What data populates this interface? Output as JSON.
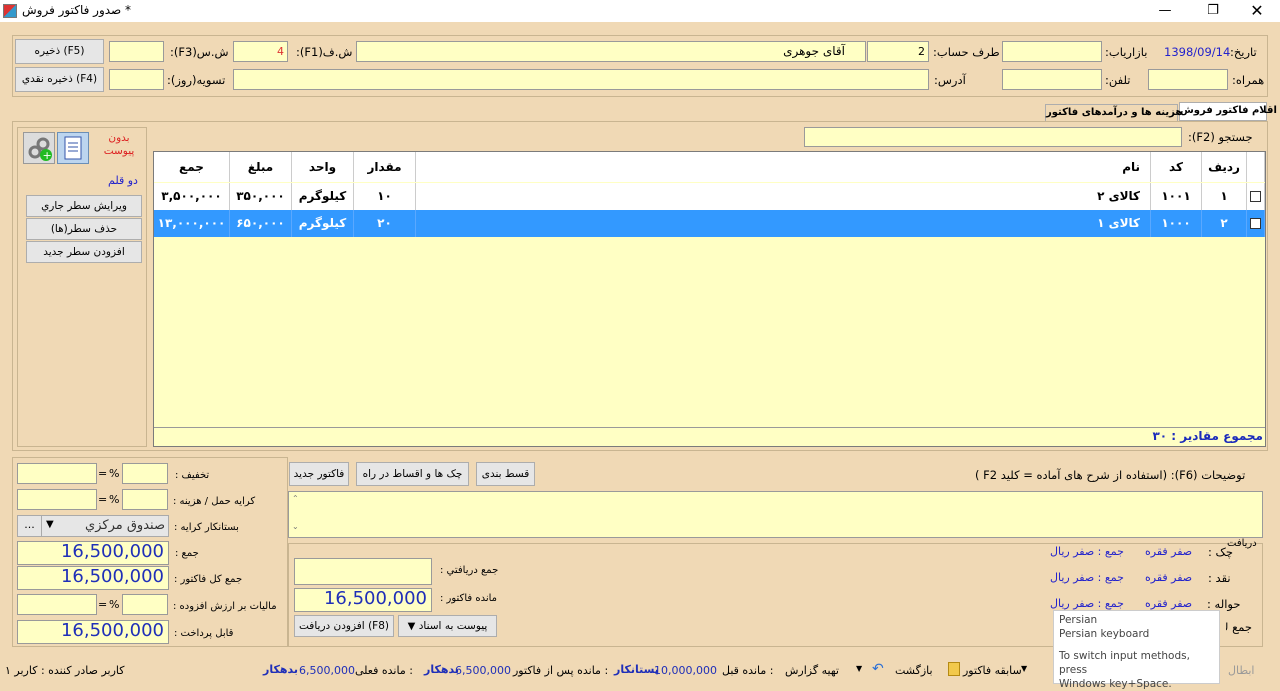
{
  "window": {
    "title": "صدور فاكتور فروش *"
  },
  "header": {
    "date_label": "تاريخ:",
    "date_value": "1398/09/14",
    "marketer_label": "بازارياب:",
    "account_label": "طرف حساب:",
    "account_code": "2",
    "account_name": "آقای  جوهری",
    "invoice_no_label": "ش.ف(F1):",
    "invoice_no": "4",
    "serial_label": "ش.س(F3):",
    "save_btn": "ذخيره (F5)",
    "companion_label": "همراه:",
    "phone_label": "تلفن:",
    "address_label": "آدرس:",
    "settle_label": "تسويه(روز):",
    "cash_save_btn": "ذخيره نقدي (F4)"
  },
  "tabs": [
    "اقلام فاكتور فروش",
    "هزينه ها و درآمدهای فاكتور"
  ],
  "search": {
    "label": "جستجو (F2):"
  },
  "side": {
    "no_attachment": "بدون\nپيوست",
    "two_pen": "دو قلم",
    "edit_row": "ويرايش سطر جاري",
    "delete_rows": "حذف سطر(ها)",
    "add_row": "افزودن سطر جديد"
  },
  "grid": {
    "headers": [
      "رديف",
      "كد",
      "نام",
      "مقدار",
      "واحد",
      "مبلغ",
      "جمع"
    ],
    "rows": [
      {
        "row": "۱",
        "code": "۱۰۰۱",
        "name": "كالای ۲",
        "qty": "۱۰",
        "unit": "كيلوگرم",
        "price": "۳۵۰,۰۰۰",
        "total": "۳,۵۰۰,۰۰۰"
      },
      {
        "row": "۲",
        "code": "۱۰۰۰",
        "name": "كالای ۱",
        "qty": "۲۰",
        "unit": "كيلوگرم",
        "price": "۶۵۰,۰۰۰",
        "total": "۱۳,۰۰۰,۰۰۰"
      }
    ],
    "footer": "مجموع مقادير : ۳۰"
  },
  "bottom": {
    "discount_label": "تخفيف :",
    "freight_label": "كرايه حمل / هزينه :",
    "freight_creditor_label": "بستانكار كرايه :",
    "freight_creditor_value": "صندوق مركزي",
    "sum_label": "جمع :",
    "sum_value": "16,500,000",
    "invoice_total_label": "جمع كل فاكتور :",
    "invoice_total_value": "16,500,000",
    "vat_label": "ماليات بر ارزش افزوده :",
    "payable_label": "قابل پرداخت :",
    "payable_value": "16,500,000",
    "pct": "%",
    "eq": "=",
    "new_invoice": "فاكتور جديد",
    "cheques": "چک ها و اقساط در راه",
    "installments": "قسط بندی",
    "notes_label": "توضيحات (F6): (استفاده از شرح های آماده = كليد F2 )",
    "received_total_label": "جمع دريافتي :",
    "invoice_remaining_label": "مانده فاكتور :",
    "invoice_remaining_value": "16,500,000",
    "add_receipt": "افزودن دريافت (F8)",
    "attach_doc": "پيوست به اسناد",
    "receipt_title": "دريافت",
    "cheque_label": "چک :",
    "cash_label": "نقد :",
    "transfer_label": "حواله :",
    "sum_cut": "جمع ك",
    "zero_count": "صفر فقره",
    "zero_sum": "جمع : صفر ريال"
  },
  "tooltip": {
    "line1": "Persian",
    "line2": "Persian keyboard",
    "line3": "To switch input methods, press",
    "line4": "Windows key+Space."
  },
  "status": {
    "issuer": "كاربر صادر كننده : كاربر ۱",
    "current_balance_label": "مانده فعلی :",
    "current_balance": "6,500,000",
    "current_balance_type": "بدهكار",
    "after_invoice_label": "مانده پس از فاكتور :",
    "after_invoice": "6,500,000",
    "after_invoice_type": "بدهكار",
    "before_label": "مانده قبل :",
    "before": "10,000,000",
    "before_type": "بستانكار",
    "report": "تهيه گزارش",
    "back": "بازگشت",
    "history": "سابقه فاكتور",
    "cancel": "ابطال"
  }
}
